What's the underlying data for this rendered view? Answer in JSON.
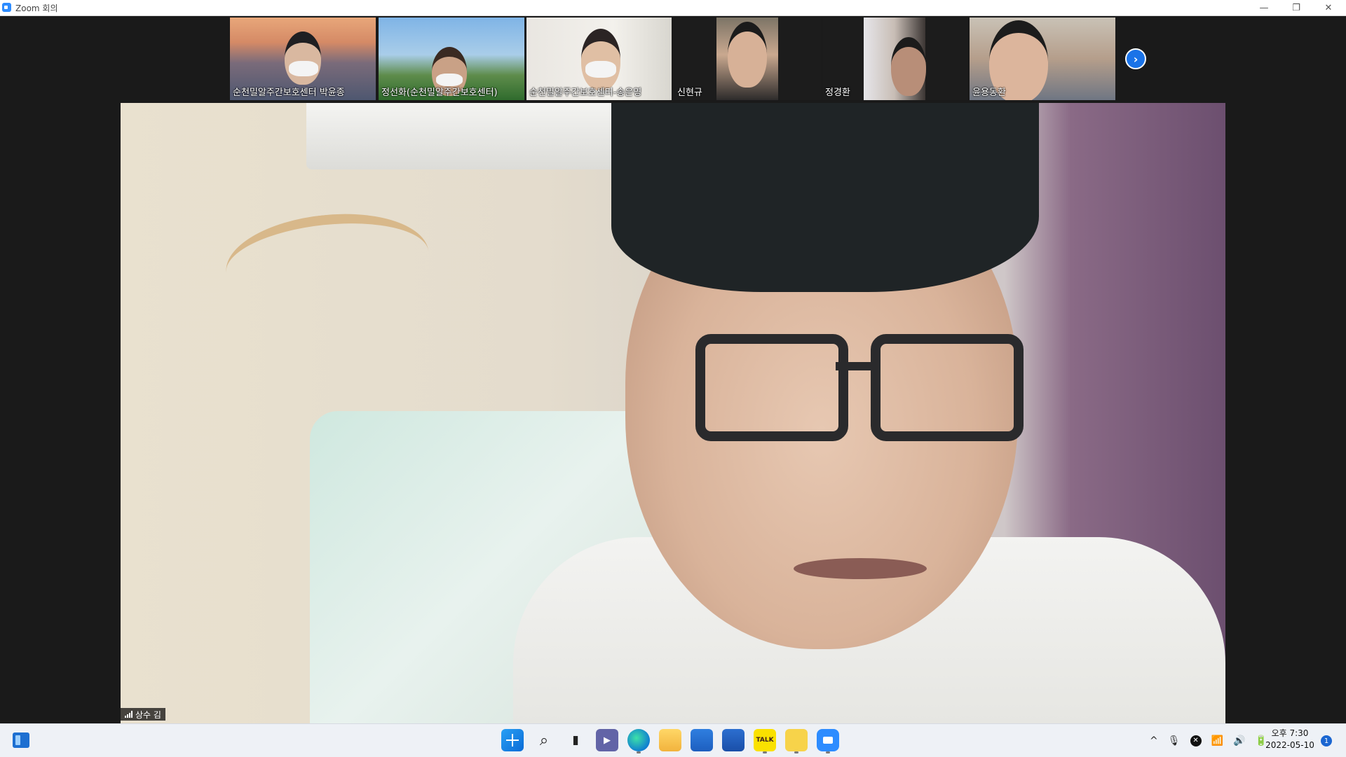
{
  "window": {
    "title": "Zoom 회의",
    "controls": {
      "minimize": "—",
      "restore": "❐",
      "close": "✕"
    }
  },
  "participants": [
    {
      "name": "순천밀알주간보호센터 박윤종",
      "video": true
    },
    {
      "name": "정선화(순천밀알주간보호센터)",
      "video": true
    },
    {
      "name": "순천밀알주간보호센터-송은영",
      "video": true
    },
    {
      "name": "신현규",
      "video": true
    },
    {
      "name": "정경환",
      "video": true
    },
    {
      "name": "윤용동환",
      "video": true
    }
  ],
  "thumbstrip": {
    "next_icon": "chevron-right-icon",
    "next_glyph": "›"
  },
  "active_speaker": {
    "name": "상수 김",
    "signal_icon": "signal-bars-icon"
  },
  "taskbar": {
    "apps": [
      "start",
      "search",
      "task-view",
      "teams-chat",
      "edge",
      "file-explorer",
      "microsoft-store",
      "mail",
      "kakaotalk",
      "sticky-notes",
      "zoom"
    ],
    "kakao_label": "TALK",
    "tray": {
      "chevron": "^",
      "mic": "🎙",
      "x_badge": "✕",
      "wifi": "📶",
      "volume": "🔊",
      "battery": "🔋"
    },
    "clock_time": "오후 7:30",
    "clock_date": "2022-05-10",
    "notification_count": "1"
  },
  "colors": {
    "accent": "#2d8cff",
    "next_button": "#1a73e8",
    "background": "#1a1a1a"
  }
}
